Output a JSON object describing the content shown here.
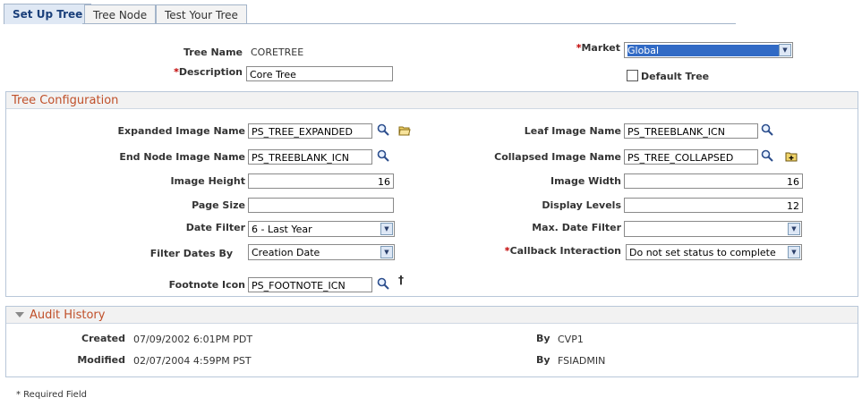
{
  "tabs": [
    {
      "label": "Set Up Tree"
    },
    {
      "label": "Tree Node"
    },
    {
      "label": "Test Your Tree"
    }
  ],
  "header": {
    "tree_name_label": "Tree Name",
    "tree_name_value": "CORETREE",
    "description_label": "Description",
    "description_value": "Core Tree",
    "market_label": "Market",
    "market_value": "Global",
    "default_tree_label": "Default Tree",
    "required_marker": "*"
  },
  "tree_config": {
    "title": "Tree Configuration",
    "expanded_image_label": "Expanded Image Name",
    "expanded_image_value": "PS_TREE_EXPANDED",
    "end_node_image_label": "End Node Image Name",
    "end_node_image_value": "PS_TREEBLANK_ICN",
    "image_height_label": "Image Height",
    "image_height_value": "16",
    "page_size_label": "Page Size",
    "page_size_value": "",
    "date_filter_label": "Date Filter",
    "date_filter_value": "6 - Last Year",
    "filter_dates_by_label": "Filter Dates By",
    "filter_dates_by_value": "Creation Date",
    "footnote_icon_label": "Footnote Icon",
    "footnote_icon_value": "PS_FOOTNOTE_ICN",
    "footnote_symbol": "†",
    "leaf_image_label": "Leaf Image Name",
    "leaf_image_value": "PS_TREEBLANK_ICN",
    "collapsed_image_label": "Collapsed Image Name",
    "collapsed_image_value": "PS_TREE_COLLAPSED",
    "image_width_label": "Image Width",
    "image_width_value": "16",
    "display_levels_label": "Display Levels",
    "display_levels_value": "12",
    "max_date_filter_label": "Max. Date Filter",
    "max_date_filter_value": "",
    "callback_label": "Callback Interaction",
    "callback_value": "Do not set status to complete"
  },
  "audit": {
    "title": "Audit History",
    "created_label": "Created",
    "created_value": "07/09/2002  6:01PM PDT",
    "modified_label": "Modified",
    "modified_value": "02/07/2004  4:59PM PST",
    "by_label": "By",
    "created_by": "CVP1",
    "modified_by": "FSIADMIN"
  },
  "footer": {
    "required_note": "* Required Field"
  },
  "colors": {
    "section_title": "#c0502a",
    "selected_highlight": "#316ac5",
    "tab_active_bg": "#dfe8f4"
  }
}
